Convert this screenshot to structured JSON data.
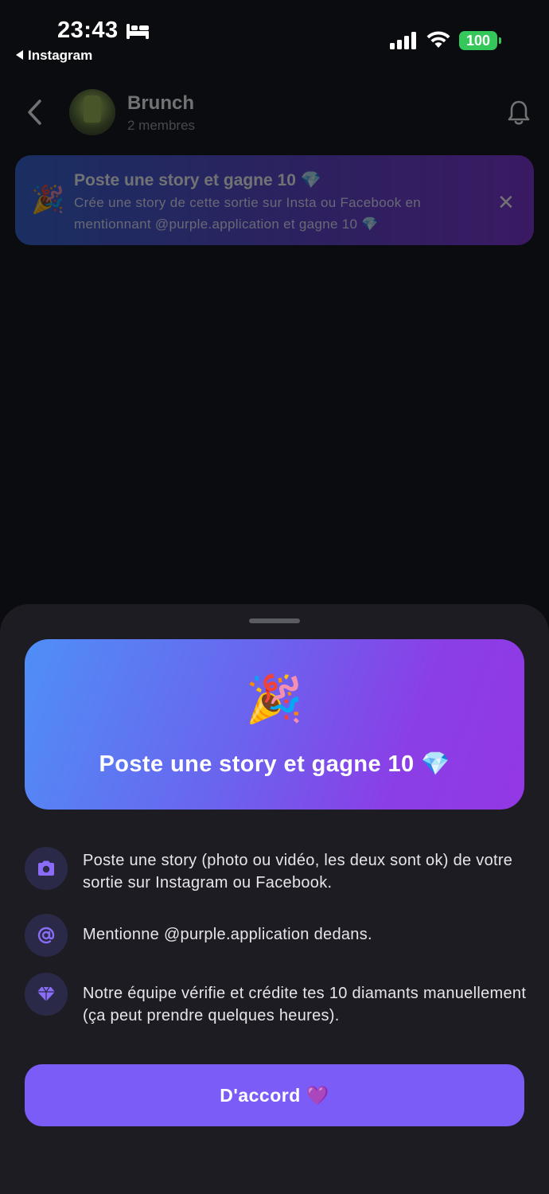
{
  "status_bar": {
    "time": "23:43",
    "back_app": "Instagram",
    "battery": "100",
    "icons": [
      "bed-icon",
      "signal-icon",
      "wifi-icon",
      "battery-icon"
    ]
  },
  "header": {
    "group_name": "Brunch",
    "members": "2 membres",
    "icons": [
      "chevron-left-icon",
      "bell-icon"
    ]
  },
  "promo_banner": {
    "emoji": "🎉",
    "title": "Poste une story et gagne 10 💎",
    "text": "Crée une story de cette sortie sur Insta ou Facebook en mentionnant @purple.application et gagne 10 💎",
    "close": "✕"
  },
  "sheet": {
    "hero_emoji": "🎉",
    "hero_title": "Poste une story et gagne 10 💎",
    "steps": [
      {
        "icon": "camera-icon",
        "text": "Poste une story (photo ou vidéo, les deux sont ok) de votre sortie sur Instagram ou Facebook."
      },
      {
        "icon": "at-sign-icon",
        "text": "Mentionne @purple.application dedans."
      },
      {
        "icon": "diamond-icon",
        "text": "Notre équipe vérifie et crédite tes 10 diamants manuellement (ça peut prendre quelques heures)."
      }
    ],
    "button_label": "D'accord 💜"
  },
  "colors": {
    "background": "#0b0c0f",
    "sheet": "#1c1c22",
    "accent": "#7c5cf6",
    "battery": "#34c759",
    "icon_circle": "#2a2a48",
    "icon_glyph": "#8b6cf7"
  }
}
